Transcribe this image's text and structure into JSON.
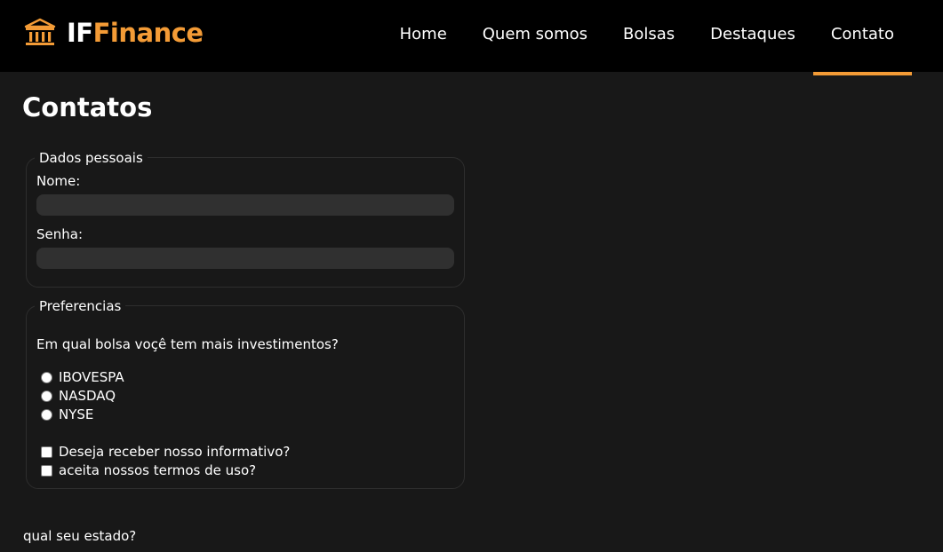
{
  "header": {
    "logo": {
      "prefix": "IF",
      "suffix": "Finance",
      "icon": "bank-building-icon"
    },
    "nav": [
      {
        "label": "Home",
        "active": false
      },
      {
        "label": "Quem somos",
        "active": false
      },
      {
        "label": "Bolsas",
        "active": false
      },
      {
        "label": "Destaques",
        "active": false
      },
      {
        "label": "Contato",
        "active": true
      }
    ],
    "accent_color": "#f39b36"
  },
  "main": {
    "title": "Contatos",
    "personal": {
      "legend": "Dados pessoais",
      "name_label": "Nome:",
      "name_value": "",
      "password_label": "Senha:",
      "password_value": ""
    },
    "preferences": {
      "legend": "Preferencias",
      "question": "Em qual bolsa voçê tem mais investimentos?",
      "options": [
        "IBOVESPA",
        "NASDAQ",
        "NYSE"
      ],
      "checkboxes": [
        "Deseja receber nosso informativo?",
        "aceita nossos termos de uso?"
      ]
    },
    "state_question": "qual seu estado?"
  }
}
